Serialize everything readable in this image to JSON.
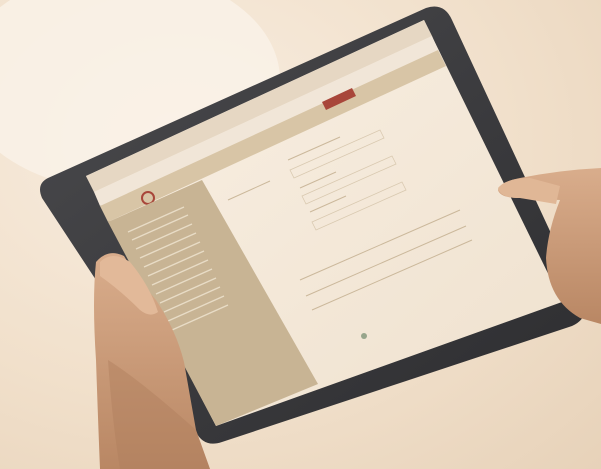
{
  "scene": {
    "description_elements": [
      "tablet-device",
      "left-hand",
      "right-hand",
      "pointing-finger",
      "browser-ui"
    ]
  },
  "colors": {
    "background": "#f3e4d0",
    "tablet_frame": "#3a3a3d",
    "screen": "#f6ecdf",
    "sidebar": "#c9b698",
    "topbar": "#d9c6a8",
    "accent": "#a8463a",
    "skin": "#d8a985"
  },
  "icons": {
    "logo": "logo-icon",
    "close": "close-icon"
  },
  "browser": {
    "tabs": [
      "",
      "",
      "",
      "",
      "",
      ""
    ],
    "address": ""
  },
  "webpage": {
    "nav_items": [
      "",
      "",
      "",
      "",
      "",
      ""
    ],
    "sidebar_items": [
      "",
      "",
      "",
      "",
      "",
      "",
      "",
      "",
      "",
      "",
      "",
      ""
    ],
    "form_fields": [
      "",
      "",
      "",
      "",
      ""
    ]
  }
}
